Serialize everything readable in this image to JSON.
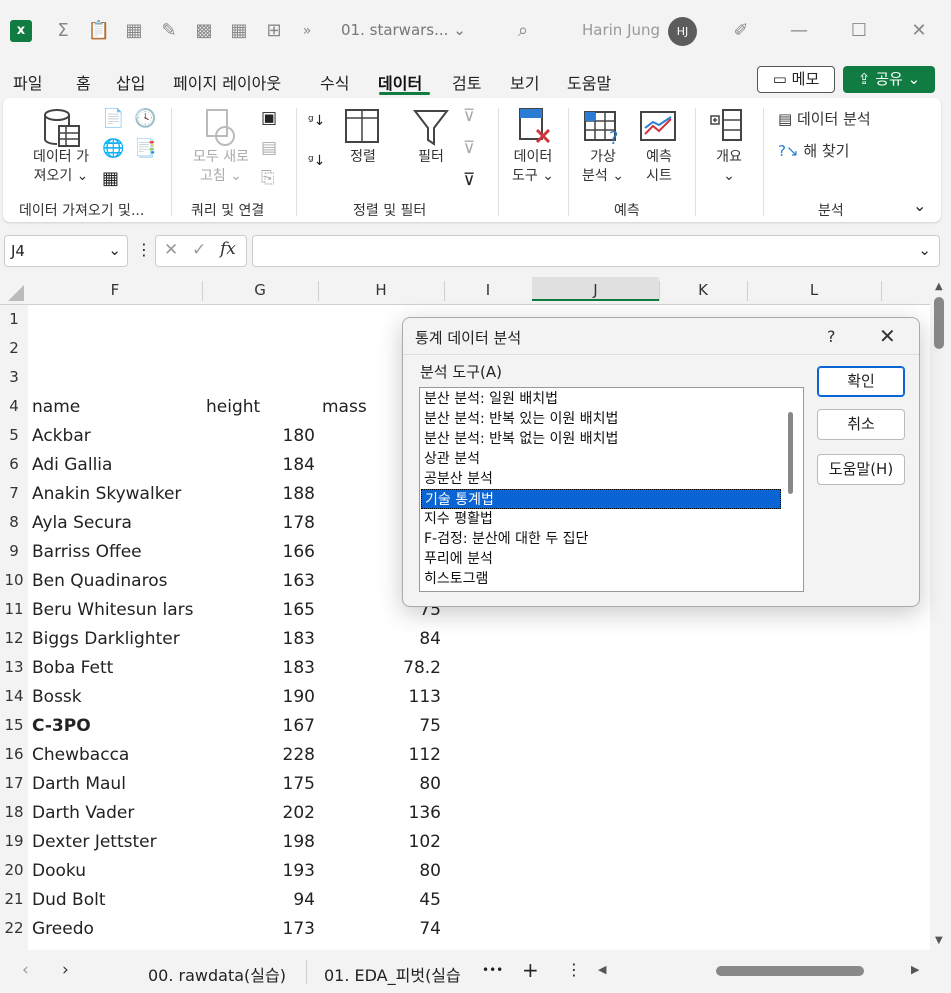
{
  "titlebar": {
    "doc_title": "01. starwars... ⌄",
    "user_name": "Harin Jung",
    "avatar_initials": "HJ"
  },
  "menu": {
    "tabs": [
      "파일",
      "홈",
      "삽입",
      "페이지 레이아웃",
      "수식",
      "데이터",
      "검토",
      "보기",
      "도움말"
    ],
    "memo_label": "메모",
    "share_label": "공유"
  },
  "ribbon": {
    "get_data_line1": "데이터 가",
    "get_data_line2": "져오기 ⌄",
    "refresh_all_line1": "모두 새로",
    "refresh_all_line2": "고침 ⌄",
    "sort_label": "정렬",
    "filter_label": "필터",
    "data_tools_line1": "데이터",
    "data_tools_line2": "도구 ⌄",
    "whatif_line1": "가상",
    "whatif_line2": "분석 ⌄",
    "forecast_line1": "예측",
    "forecast_line2": "시트",
    "outline_label": "개요",
    "outline_chev": "⌄",
    "data_analysis_label": "데이터 분석",
    "solver_label": "해 찾기",
    "groups": [
      "데이터 가져오기 및...",
      "쿼리 및 연결",
      "정렬 및 필터",
      "예측",
      "분석"
    ]
  },
  "formula_bar": {
    "name_box": "J4",
    "fx": "fx",
    "formula": ""
  },
  "sheet": {
    "columns": [
      "F",
      "G",
      "H",
      "I",
      "J",
      "K",
      "L"
    ],
    "rows": [
      "1",
      "2",
      "3",
      "4",
      "5",
      "6",
      "7",
      "8",
      "9",
      "10",
      "11",
      "12",
      "13",
      "14",
      "15",
      "16",
      "17",
      "18",
      "19",
      "20",
      "21",
      "22"
    ],
    "headers": {
      "name": "name",
      "height": "height",
      "mass": "mass"
    },
    "data": [
      {
        "name": "Ackbar",
        "height": "180",
        "mass": ""
      },
      {
        "name": "Adi Gallia",
        "height": "184",
        "mass": ""
      },
      {
        "name": "Anakin Skywalker",
        "height": "188",
        "mass": ""
      },
      {
        "name": "Ayla Secura",
        "height": "178",
        "mass": ""
      },
      {
        "name": "Barriss Offee",
        "height": "166",
        "mass": ""
      },
      {
        "name": "Ben Quadinaros",
        "height": "163",
        "mass": ""
      },
      {
        "name": "Beru Whitesun lars",
        "height": "165",
        "mass": "75"
      },
      {
        "name": "Biggs Darklighter",
        "height": "183",
        "mass": "84"
      },
      {
        "name": "Boba Fett",
        "height": "183",
        "mass": "78.2"
      },
      {
        "name": "Bossk",
        "height": "190",
        "mass": "113"
      },
      {
        "name": "C-3PO",
        "height": "167",
        "mass": "75"
      },
      {
        "name": "Chewbacca",
        "height": "228",
        "mass": "112"
      },
      {
        "name": "Darth Maul",
        "height": "175",
        "mass": "80"
      },
      {
        "name": "Darth Vader",
        "height": "202",
        "mass": "136"
      },
      {
        "name": "Dexter Jettster",
        "height": "198",
        "mass": "102"
      },
      {
        "name": "Dooku",
        "height": "193",
        "mass": "80"
      },
      {
        "name": "Dud Bolt",
        "height": "94",
        "mass": "45"
      },
      {
        "name": "Greedo",
        "height": "173",
        "mass": "74"
      }
    ]
  },
  "statusbar": {
    "sheet_tabs": [
      "00. rawdata(실습)",
      "01. EDA_피벗(실습"
    ],
    "more": "•••",
    "add": "+",
    "menu": "⋮"
  },
  "dialog": {
    "title": "통계 데이터 분석",
    "help": "?",
    "close": "✕",
    "tools_label": "분석 도구(A)",
    "tools": [
      "분산 분석: 일원 배치법",
      "분산 분석: 반복 있는 이원 배치법",
      "분산 분석: 반복 없는 이원 배치법",
      "상관 분석",
      "공분산 분석",
      "기술 통계법",
      "지수 평활법",
      "F-검정: 분산에 대한 두 집단",
      "푸리에 분석",
      "히스토그램"
    ],
    "selected_tool": "기술 통계법",
    "ok_label": "확인",
    "cancel_label": "취소",
    "help_label": "도움말(H)"
  }
}
